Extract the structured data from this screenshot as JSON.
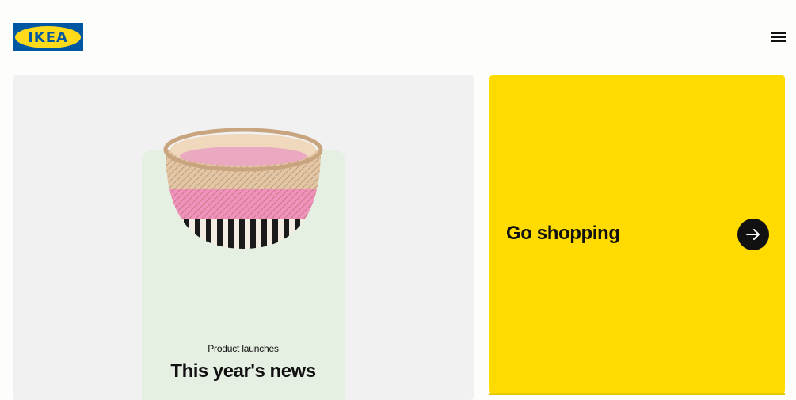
{
  "header": {
    "logo_text": "IKEA",
    "menu_icon": "hamburger-menu-icon"
  },
  "promo": {
    "eyebrow": "Product launches",
    "title": "This year's news",
    "image": "woven-basket-image"
  },
  "shopping": {
    "title": "Go shopping",
    "arrow_icon": "arrow-right-icon"
  },
  "colors": {
    "brand_blue": "#0058a3",
    "brand_yellow": "#ffdb00",
    "inner_card": "#e5efe2",
    "card_grey": "#f1f1f2"
  }
}
